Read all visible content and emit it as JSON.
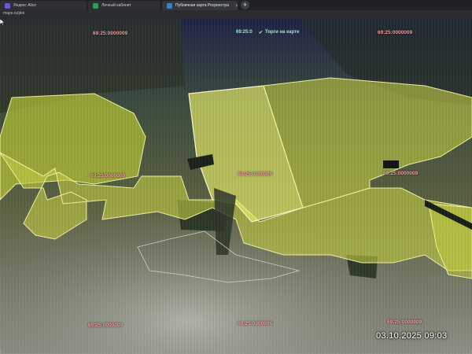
{
  "browser": {
    "tabs": [
      {
        "label": "Яндекс Alice",
        "icon": "assistant-icon",
        "active": false
      },
      {
        "label": "Личный кабинет",
        "icon": "account-icon",
        "active": false
      },
      {
        "label": "Публичная карта Росреестра",
        "icon": "map-icon",
        "active": true
      }
    ],
    "url": "maps.ru/pkk",
    "new_tab_icon": "plus-icon"
  },
  "map_toolbar": {
    "zoom_level": "69:25:0",
    "trade_toggle_label": "Торги на карте",
    "trade_toggle_checked": true
  },
  "parcels": {
    "top_left": "69:25:0000009",
    "top_center": "69:25:0",
    "top_right": "69:25:0000009",
    "left_mid": "69:25:0000009",
    "center": "69:25:0000009",
    "right_mid": "69:25:0000009",
    "bottom_left": "69:25:0000009",
    "bottom_center": "69:25:0000009",
    "bottom_right": "69:25:0000009"
  },
  "photo_timestamp": "03.10.2025  09:03",
  "colors": {
    "parcel_fill": "#c8d23a",
    "parcel_highlight": "#eef26a",
    "parcel_border": "#f3f6a8",
    "label": "#f0a0a0",
    "toolbar_text": "#9fe7c4"
  }
}
